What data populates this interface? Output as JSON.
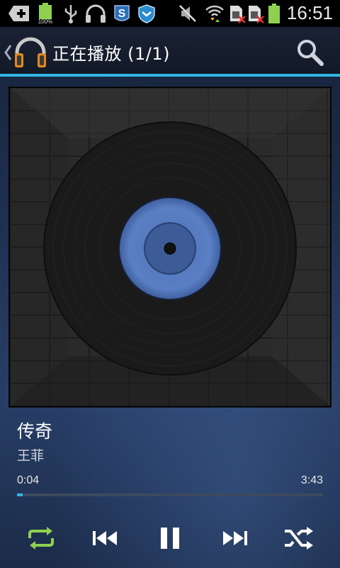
{
  "status_bar": {
    "battery_percent_label": "100%",
    "time": "16:51",
    "icons": [
      "add-icon",
      "battery-icon",
      "usb-icon",
      "headphones-icon",
      "skype-icon",
      "shield-icon",
      "mute-icon",
      "wifi-icon",
      "sim-no-signal-icon",
      "sim-no-signal-icon",
      "battery-icon"
    ]
  },
  "action_bar": {
    "title": "正在播放 (1/1)",
    "icons": [
      "back-chevron-icon",
      "music-app-icon",
      "search-icon"
    ]
  },
  "track": {
    "title": "传奇",
    "artist": "王菲"
  },
  "playback": {
    "current_time": "0:04",
    "total_time": "3:43",
    "progress": 0.018
  },
  "controls": [
    "repeat-icon",
    "previous-icon",
    "pause-icon",
    "next-icon",
    "shuffle-icon"
  ],
  "colors": {
    "accent": "#33b5e5",
    "repeat_active": "#8fd14f",
    "record_label": "#5a7fc4"
  }
}
